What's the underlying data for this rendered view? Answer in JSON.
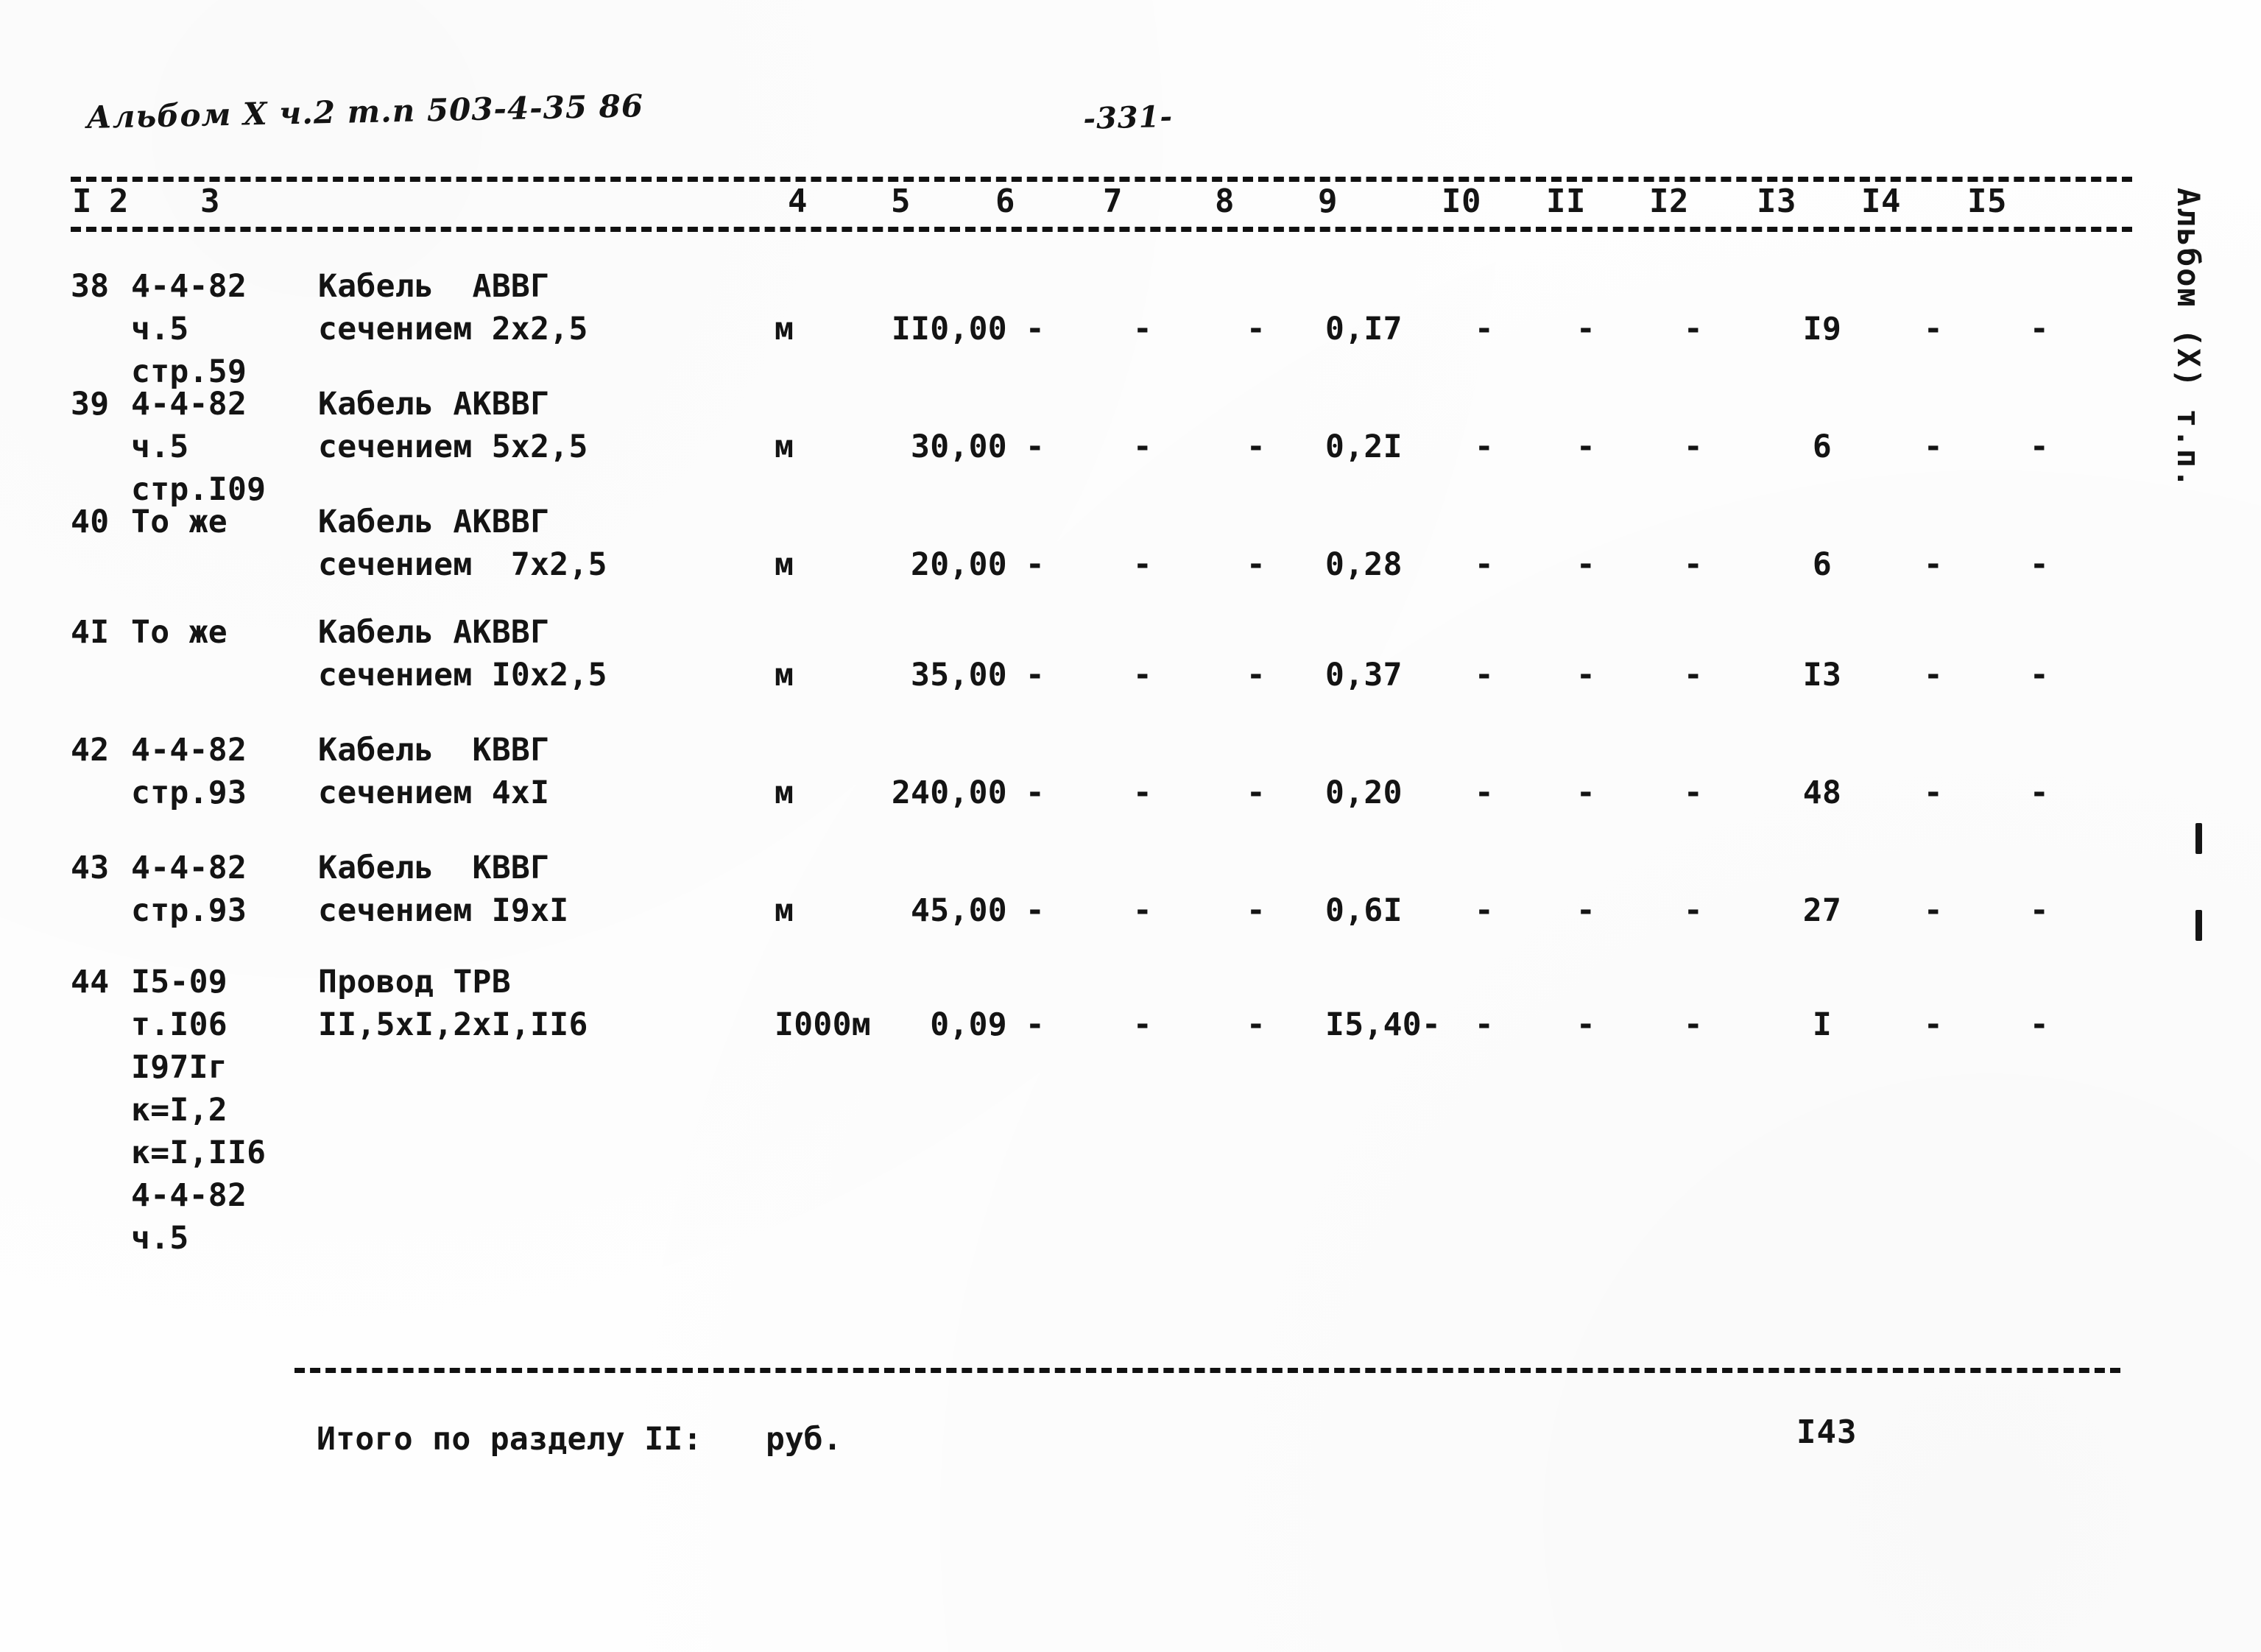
{
  "header": {
    "handwritten_title": "Альбом X ч.2 т.п 503-4-35 86",
    "page_number": "-331-"
  },
  "margin": {
    "vertical_label": "Альбом (X) т.п."
  },
  "table": {
    "column_numbers": [
      "I",
      "2",
      "3",
      "4",
      "5",
      "6",
      "7",
      "8",
      "9",
      "I0",
      "II",
      "I2",
      "I3",
      "I4",
      "I5"
    ],
    "rows": [
      {
        "num": "38",
        "justification": [
          "4-4-82",
          "ч.5",
          "стр.59"
        ],
        "name": [
          "Кабель  АВВГ",
          "сечением 2х2,5"
        ],
        "unit": "м",
        "qty": "II0,00",
        "c6": "-",
        "c7": "-",
        "c8": "-",
        "c9": "0,I7",
        "c10": "-",
        "c11": "-",
        "c12": "-",
        "c13": "I9",
        "c14": "-",
        "c15": "-"
      },
      {
        "num": "39",
        "justification": [
          "4-4-82",
          "ч.5",
          "стр.I09"
        ],
        "name": [
          "Кабель АКВВГ",
          "сечением 5х2,5"
        ],
        "unit": "м",
        "qty": "30,00",
        "c6": "-",
        "c7": "-",
        "c8": "-",
        "c9": "0,2I",
        "c10": "-",
        "c11": "-",
        "c12": "-",
        "c13": "6",
        "c14": "-",
        "c15": "-"
      },
      {
        "num": "40",
        "justification": [
          "То же"
        ],
        "name": [
          "Кабель АКВВГ",
          "сечением  7х2,5"
        ],
        "unit": "м",
        "qty": "20,00",
        "c6": "-",
        "c7": "-",
        "c8": "-",
        "c9": "0,28",
        "c10": "-",
        "c11": "-",
        "c12": "-",
        "c13": "6",
        "c14": "-",
        "c15": "-"
      },
      {
        "num": "4I",
        "justification": [
          "То же"
        ],
        "name": [
          "Кабель АКВВГ",
          "сечением I0х2,5"
        ],
        "unit": "м",
        "qty": "35,00",
        "c6": "-",
        "c7": "-",
        "c8": "-",
        "c9": "0,37",
        "c10": "-",
        "c11": "-",
        "c12": "-",
        "c13": "I3",
        "c14": "-",
        "c15": "-"
      },
      {
        "num": "42",
        "justification": [
          "4-4-82",
          "стр.93"
        ],
        "name": [
          "Кабель  КВВГ",
          "сечением 4хI"
        ],
        "unit": "м",
        "qty": "240,00",
        "c6": "-",
        "c7": "-",
        "c8": "-",
        "c9": "0,20",
        "c10": "-",
        "c11": "-",
        "c12": "-",
        "c13": "48",
        "c14": "-",
        "c15": "-"
      },
      {
        "num": "43",
        "justification": [
          "4-4-82",
          "стр.93"
        ],
        "name": [
          "Кабель  КВВГ",
          "сечением I9хI"
        ],
        "unit": "м",
        "qty": "45,00",
        "c6": "-",
        "c7": "-",
        "c8": "-",
        "c9": "0,6I",
        "c10": "-",
        "c11": "-",
        "c12": "-",
        "c13": "27",
        "c14": "-",
        "c15": "-"
      },
      {
        "num": "44",
        "justification": [
          "I5-09",
          "т.I06",
          "I97Iг",
          "к=I,2",
          "к=I,II6",
          "4-4-82",
          "ч.5"
        ],
        "name": [
          "Провод ТРВ",
          "II,5хI,2хI,II6"
        ],
        "unit": "I000м",
        "qty": "0,09",
        "c6": "-",
        "c7": "-",
        "c8": "-",
        "c9": "I5,40-",
        "c10": "-",
        "c11": "-",
        "c12": "-",
        "c13": "I",
        "c14": "-",
        "c15": "-"
      }
    ]
  },
  "total": {
    "label": "Итого по разделу II:",
    "unit": "руб.",
    "value": "I43"
  }
}
